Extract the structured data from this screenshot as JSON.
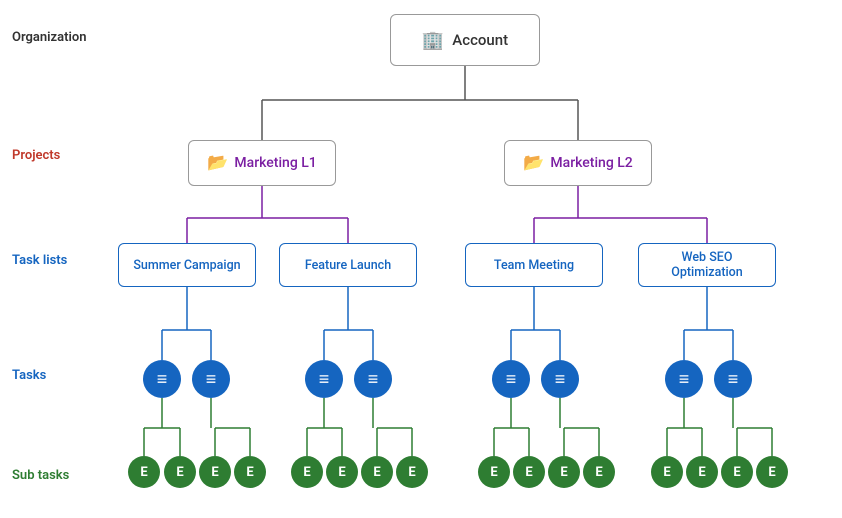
{
  "labels": {
    "organization": "Organization",
    "projects": "Projects",
    "task_lists": "Task lists",
    "tasks": "Tasks",
    "sub_tasks": "Sub tasks"
  },
  "nodes": {
    "account": "Account",
    "project_l1": "Marketing L1",
    "project_l2": "Marketing L2",
    "tasklist_1": "Summer Campaign",
    "tasklist_2": "Feature Launch",
    "tasklist_3": "Team Meeting",
    "tasklist_4": "Web SEO Optimization"
  },
  "colors": {
    "account_border": "#999",
    "project_text": "#7b1fa2",
    "project_border": "#7b1fa2",
    "tasklist_border": "#1565c0",
    "tasklist_text": "#1565c0",
    "task_bg": "#1565c0",
    "subtask_bg": "#2e7d32",
    "line_account": "#555",
    "line_project": "#7b1fa2",
    "line_tasklist": "#1565c0",
    "line_task": "#1565c0",
    "line_subtask": "#2e7d32",
    "label_project": "#c0392b",
    "label_task": "#1565c0",
    "label_subtask": "#2e7d32"
  }
}
